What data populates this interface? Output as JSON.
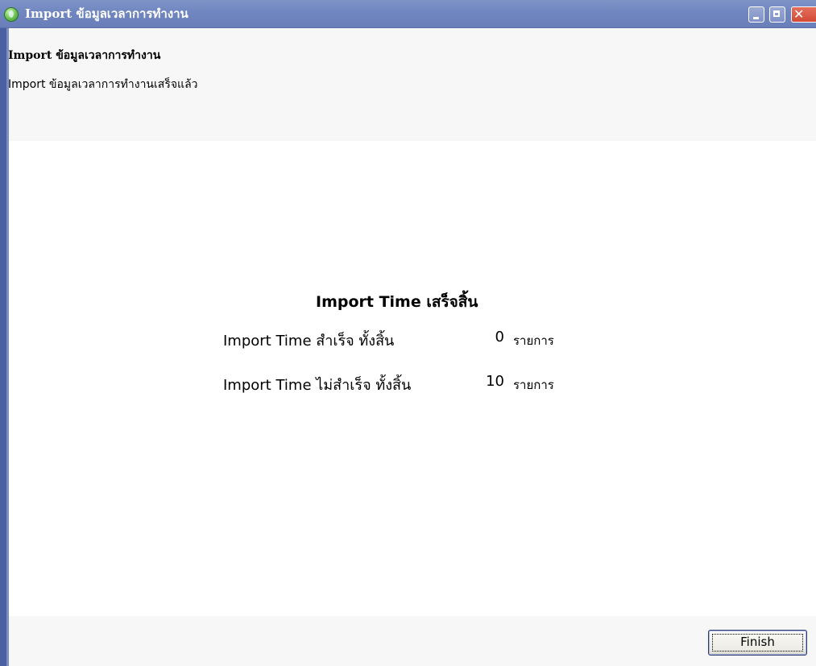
{
  "window": {
    "title": "Import ข้อมูลเวลาการทำงาน",
    "icon": "globe-app-icon",
    "controls": {
      "minimize": "minimize-icon",
      "maximize": "maximize-icon",
      "close": "close-icon"
    }
  },
  "header": {
    "title": "Import ข้อมูลเวลาการทำงาน",
    "description": "Import ข้อมูลเวลาการทำงานเสร็จแล้ว"
  },
  "result": {
    "title": "Import Time เสร็จสิ้น",
    "rows": [
      {
        "label": "Import Time สำเร็จ ทั้งสิ้น",
        "count": "0",
        "unit": "รายการ"
      },
      {
        "label": "Import Time ไม่สำเร็จ ทั้งสิ้น",
        "count": "10",
        "unit": "รายการ"
      }
    ]
  },
  "footer": {
    "finish_label": "Finish"
  },
  "colors": {
    "titlebar": "#7086c0",
    "close_button": "#d24a35",
    "panel_background": "#f7f7f7",
    "left_border": "#4a60a0"
  }
}
